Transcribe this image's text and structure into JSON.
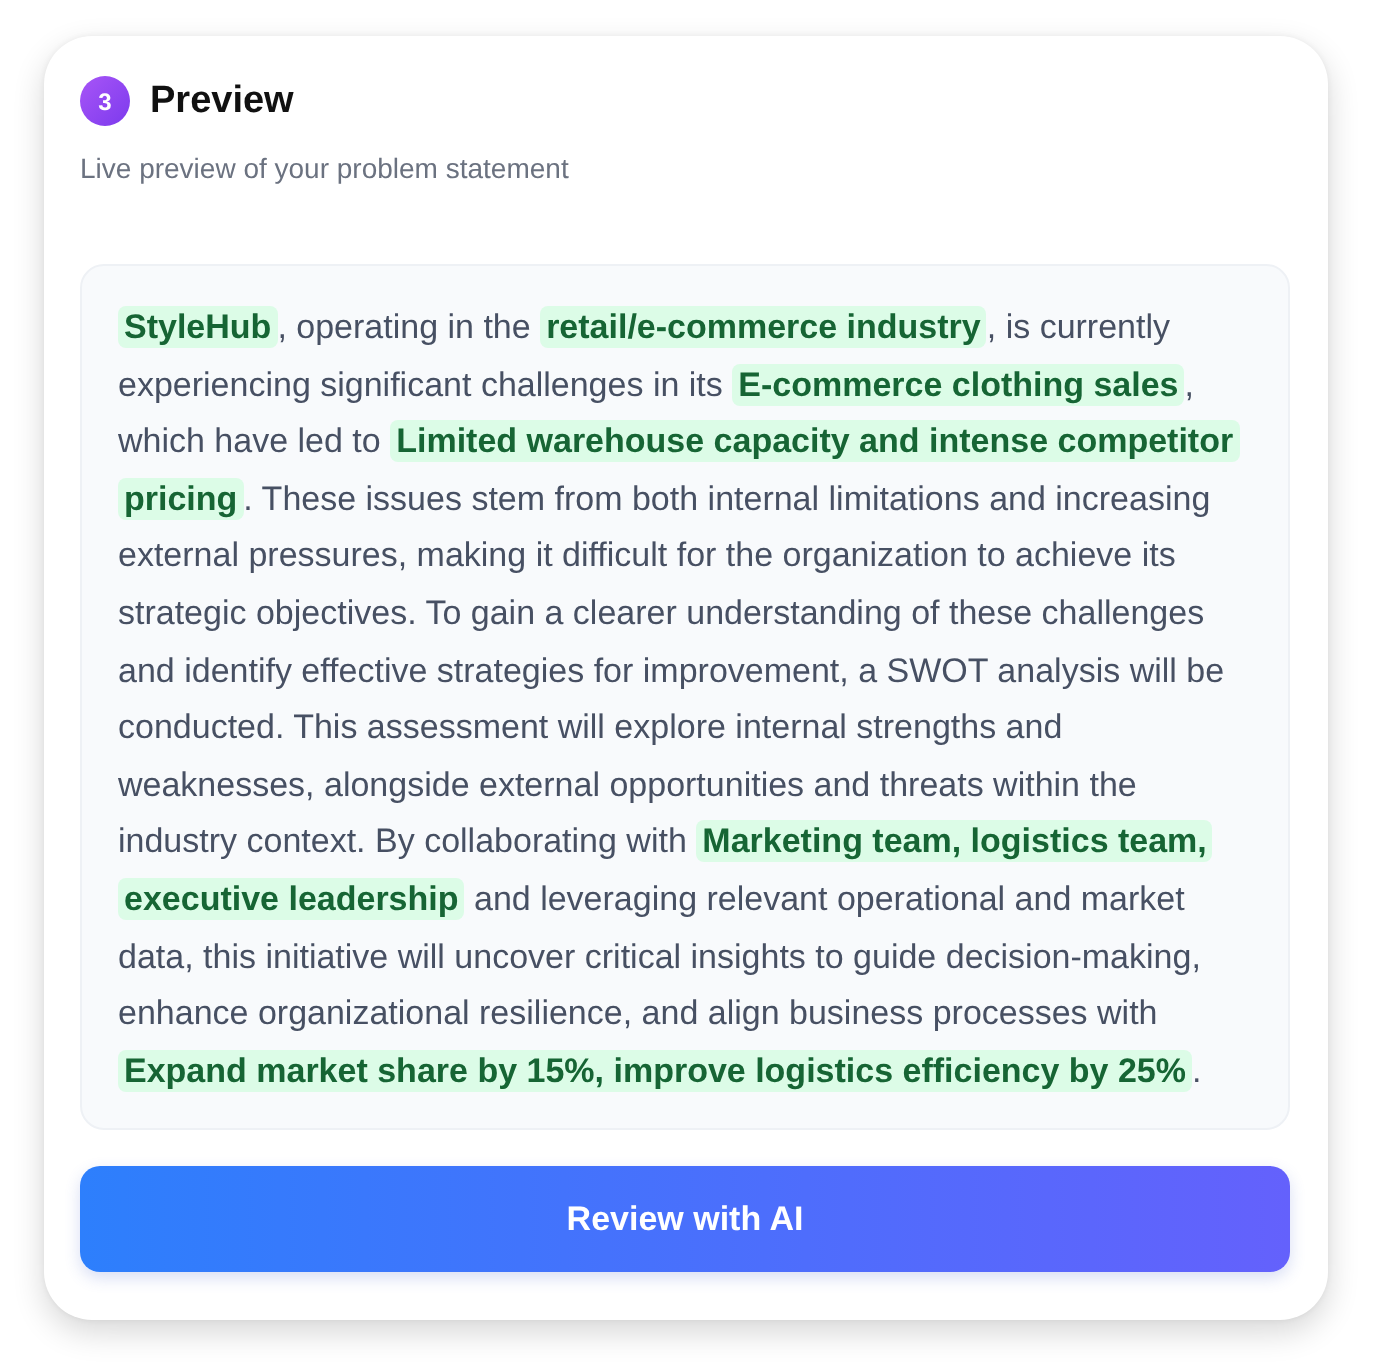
{
  "step": {
    "number": "3",
    "title": "Preview",
    "subtitle": "Live preview of your problem statement"
  },
  "preview": {
    "text": "**StyleHub**, operating in the **retail/e-commerce industry**, is currently experiencing significant challenges in its **E-commerce clothing sales**, which have led to **Limited warehouse capacity and intense competitor pricing**. These issues stem from both internal limitations and increasing external pressures, making it difficult for the organization to achieve its strategic objectives. To gain a clearer understanding of these challenges and identify effective strategies for improvement, a SWOT analysis will be conducted. This assessment will explore internal strengths and weaknesses, alongside external opportunities and threats within the industry context. By collaborating with **Marketing team, logistics team, executive leadership** and leveraging relevant operational and market data, this initiative will uncover critical insights to guide decision-making, enhance organizational resilience, and align business processes with **Expand market share by 15%, improve logistics efficiency by 25%**."
  },
  "button": {
    "label": "Review with AI"
  }
}
